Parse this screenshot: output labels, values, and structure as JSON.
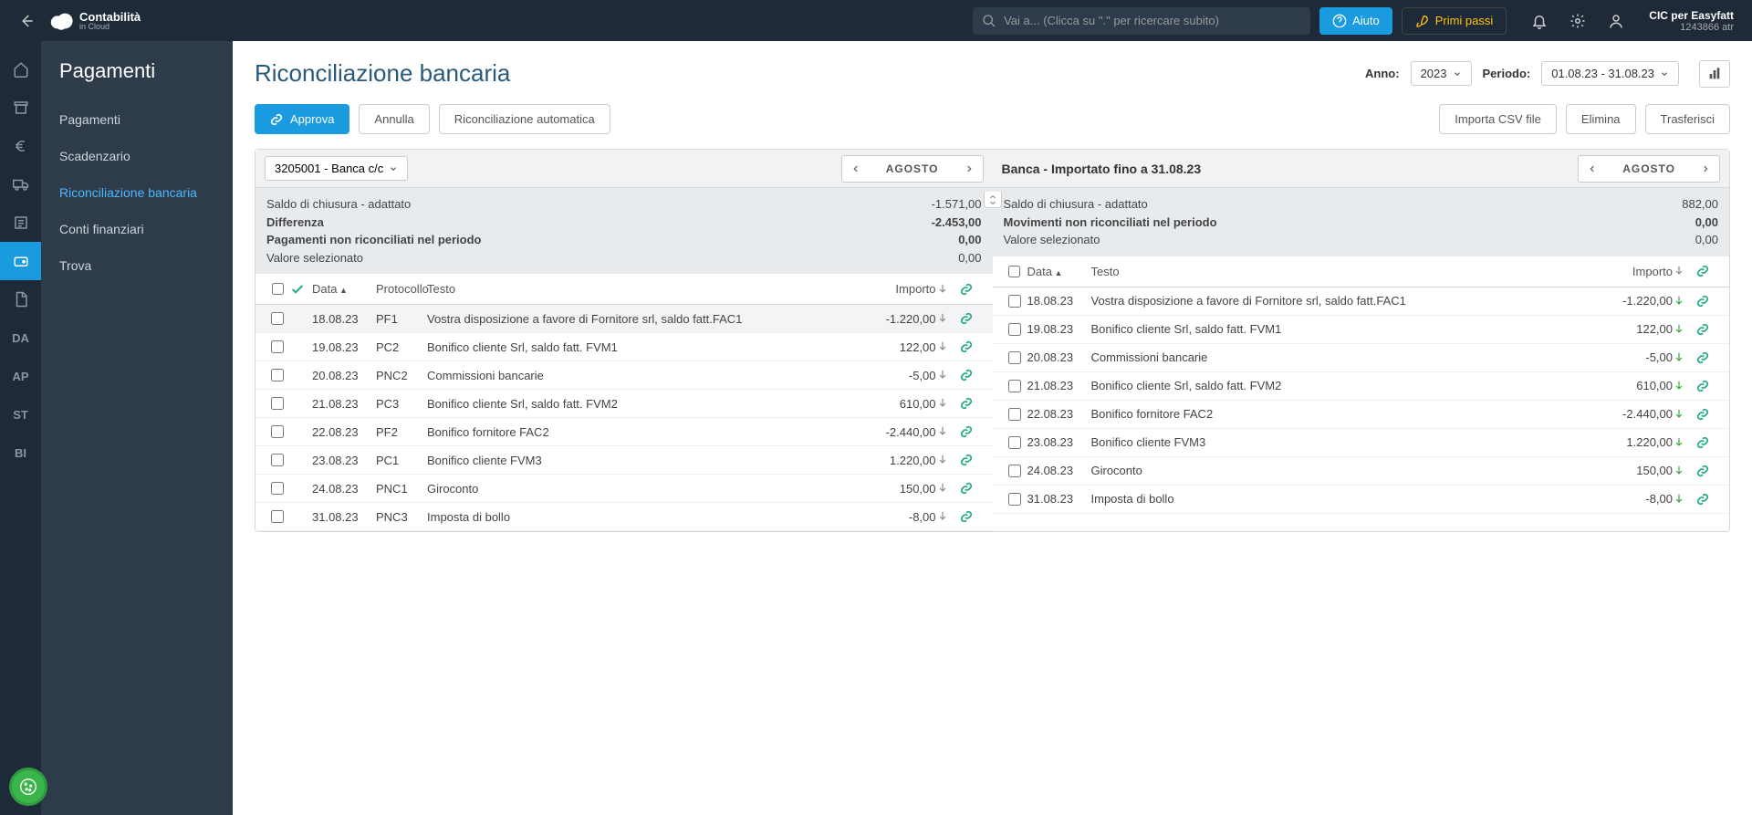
{
  "header": {
    "logo_main": "Contabilità",
    "logo_sub": "in Cloud",
    "search_placeholder": "Vai a... (Clicca su \".\" per ricercare subito)",
    "help": "Aiuto",
    "first_steps": "Primi passi",
    "user_name": "CIC per Easyfatt",
    "user_id": "1243866 atr"
  },
  "rail": [
    "home",
    "archive",
    "euro",
    "truck",
    "list",
    "wallet",
    "doc",
    "DA",
    "AP",
    "ST",
    "BI"
  ],
  "sidebar": {
    "title": "Pagamenti",
    "items": [
      "Pagamenti",
      "Scadenzario",
      "Riconciliazione bancaria",
      "Conti finanziari",
      "Trova"
    ],
    "active_index": 2
  },
  "page": {
    "title": "Riconciliazione bancaria",
    "year_label": "Anno:",
    "year_value": "2023",
    "period_label": "Periodo:",
    "period_value": "01.08.23 - 31.08.23"
  },
  "toolbar": {
    "approve": "Approva",
    "cancel": "Annulla",
    "auto": "Riconciliazione automatica",
    "import": "Importa CSV file",
    "delete": "Elimina",
    "transfer": "Trasferisci"
  },
  "left_panel": {
    "account": "3205001 - Banca c/c",
    "month": "AGOSTO",
    "summary": [
      {
        "label": "Saldo di chiusura - adattato",
        "value": "-1.571,00",
        "bold": false
      },
      {
        "label": "Differenza",
        "value": "-2.453,00",
        "bold": true
      },
      {
        "label": "Pagamenti non riconciliati nel periodo",
        "value": "0,00",
        "bold": true
      },
      {
        "label": "Valore selezionato",
        "value": "0,00",
        "bold": false
      }
    ],
    "columns": {
      "date": "Data",
      "proto": "Protocollo",
      "text": "Testo",
      "amount": "Importo"
    },
    "rows": [
      {
        "date": "18.08.23",
        "proto": "PF1",
        "text": "Vostra disposizione a favore di Fornitore srl, saldo fatt.FAC1",
        "amount": "-1.220,00",
        "selected": true
      },
      {
        "date": "19.08.23",
        "proto": "PC2",
        "text": "Bonifico cliente Srl, saldo fatt. FVM1",
        "amount": "122,00",
        "selected": false
      },
      {
        "date": "20.08.23",
        "proto": "PNC2",
        "text": "Commissioni bancarie",
        "amount": "-5,00",
        "selected": false
      },
      {
        "date": "21.08.23",
        "proto": "PC3",
        "text": "Bonifico cliente Srl, saldo fatt. FVM2",
        "amount": "610,00",
        "selected": false
      },
      {
        "date": "22.08.23",
        "proto": "PF2",
        "text": "Bonifico fornitore FAC2",
        "amount": "-2.440,00",
        "selected": false
      },
      {
        "date": "23.08.23",
        "proto": "PC1",
        "text": "Bonifico cliente FVM3",
        "amount": "1.220,00",
        "selected": false
      },
      {
        "date": "24.08.23",
        "proto": "PNC1",
        "text": "Giroconto",
        "amount": "150,00",
        "selected": false
      },
      {
        "date": "31.08.23",
        "proto": "PNC3",
        "text": "Imposta di bollo",
        "amount": "-8,00",
        "selected": false
      }
    ]
  },
  "right_panel": {
    "title": "Banca - Importato fino a 31.08.23",
    "month": "AGOSTO",
    "summary": [
      {
        "label": "Saldo di chiusura - adattato",
        "value": "882,00",
        "bold": false
      },
      {
        "label": "",
        "value": "",
        "bold": false
      },
      {
        "label": "Movimenti non riconciliati nel periodo",
        "value": "0,00",
        "bold": true
      },
      {
        "label": "Valore selezionato",
        "value": "0,00",
        "bold": false
      }
    ],
    "columns": {
      "date": "Data",
      "text": "Testo",
      "amount": "Importo"
    },
    "rows": [
      {
        "date": "18.08.23",
        "text": "Vostra disposizione a favore di Fornitore srl, saldo fatt.FAC1",
        "amount": "-1.220,00",
        "green": true
      },
      {
        "date": "19.08.23",
        "text": "Bonifico cliente Srl, saldo fatt. FVM1",
        "amount": "122,00",
        "green": true
      },
      {
        "date": "20.08.23",
        "text": "Commissioni bancarie",
        "amount": "-5,00",
        "green": true
      },
      {
        "date": "21.08.23",
        "text": "Bonifico cliente Srl, saldo fatt. FVM2",
        "amount": "610,00",
        "green": true
      },
      {
        "date": "22.08.23",
        "text": "Bonifico fornitore FAC2",
        "amount": "-2.440,00",
        "green": true
      },
      {
        "date": "23.08.23",
        "text": "Bonifico cliente FVM3",
        "amount": "1.220,00",
        "green": true
      },
      {
        "date": "24.08.23",
        "text": "Giroconto",
        "amount": "150,00",
        "green": true
      },
      {
        "date": "31.08.23",
        "text": "Imposta di bollo",
        "amount": "-8,00",
        "green": true
      }
    ]
  }
}
